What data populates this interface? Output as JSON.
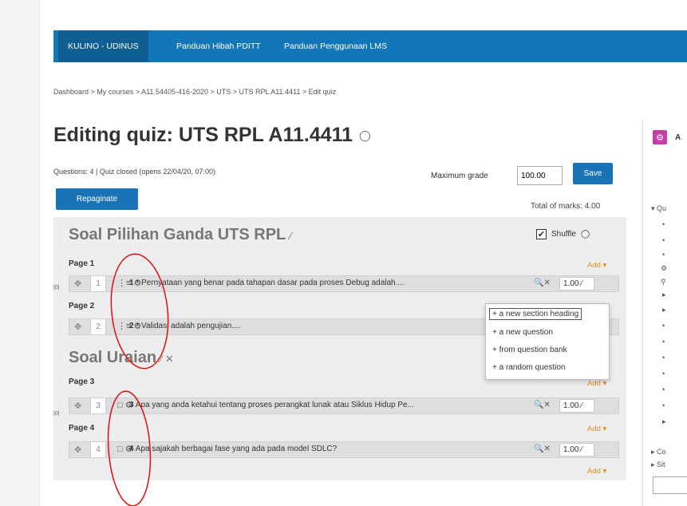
{
  "nav": {
    "items": [
      {
        "label": "KULINO - UDINUS"
      },
      {
        "label": "Panduan Hibah PDITT"
      },
      {
        "label": "Panduan Penggunaan LMS"
      }
    ]
  },
  "breadcrumb": [
    "Dashboard",
    "My courses",
    "A11.54405-416-2020",
    "UTS",
    "UTS RPL A11.4411",
    "Edit quiz"
  ],
  "breadcrumb_sep": " > ",
  "page": {
    "title": "Editing quiz: UTS RPL A11.4411",
    "quiz_info": "Questions: 4 | Quiz closed (opens 22/04/20, 07:00)",
    "max_grade_label": "Maximum grade",
    "max_grade_value": "100.00",
    "save_label": "Save",
    "repaginate_label": "Repaginate",
    "total_marks": "Total of marks: 4.00",
    "shuffle_label": "Shuffle",
    "shuffle_checked": true
  },
  "sections": [
    {
      "title": "Soal Pilihan Ganda UTS RPL"
    },
    {
      "title": "Soal Uraian"
    }
  ],
  "pages": [
    {
      "label": "Page 1",
      "add": "Add"
    },
    {
      "label": "Page 2"
    },
    {
      "label": "Page 3",
      "add": "Add"
    },
    {
      "label": "Page 4",
      "add": "Add"
    }
  ],
  "slots": [
    {
      "number": "1",
      "qnum": "1",
      "text": "Pernyataan yang benar pada tahapan dasar pada proses Debug adalah....",
      "mark": "1.00",
      "icon": "multichoice-icon"
    },
    {
      "number": "2",
      "qnum": "2",
      "text": "Validasi adalah pengujian....",
      "mark": "",
      "icon": "multichoice-icon"
    },
    {
      "number": "3",
      "qnum": "3",
      "text": "Apa yang anda ketahui tentang proses perangkat lunak atau Siklus Hidup Pe...",
      "mark": "1.00",
      "icon": "essay-icon"
    },
    {
      "number": "4",
      "qnum": "4",
      "text": "Apa sajakah  berbagai fase yang ada pada model  SDLC?",
      "mark": "1.00",
      "icon": "essay-icon"
    }
  ],
  "last_add": "Add",
  "add_menu": [
    {
      "label": "+ a new section heading"
    },
    {
      "label": "+ a new question"
    },
    {
      "label": "+ from question bank"
    },
    {
      "label": "+ a random question"
    }
  ],
  "right_panel": {
    "block_label": "A",
    "tree_items": [
      "Qu",
      "Co",
      "Sit"
    ]
  },
  "colors": {
    "navbar": "#1277b8",
    "button": "#1a73b5",
    "add_link": "#e28a1c",
    "annotation": "#e01010"
  }
}
